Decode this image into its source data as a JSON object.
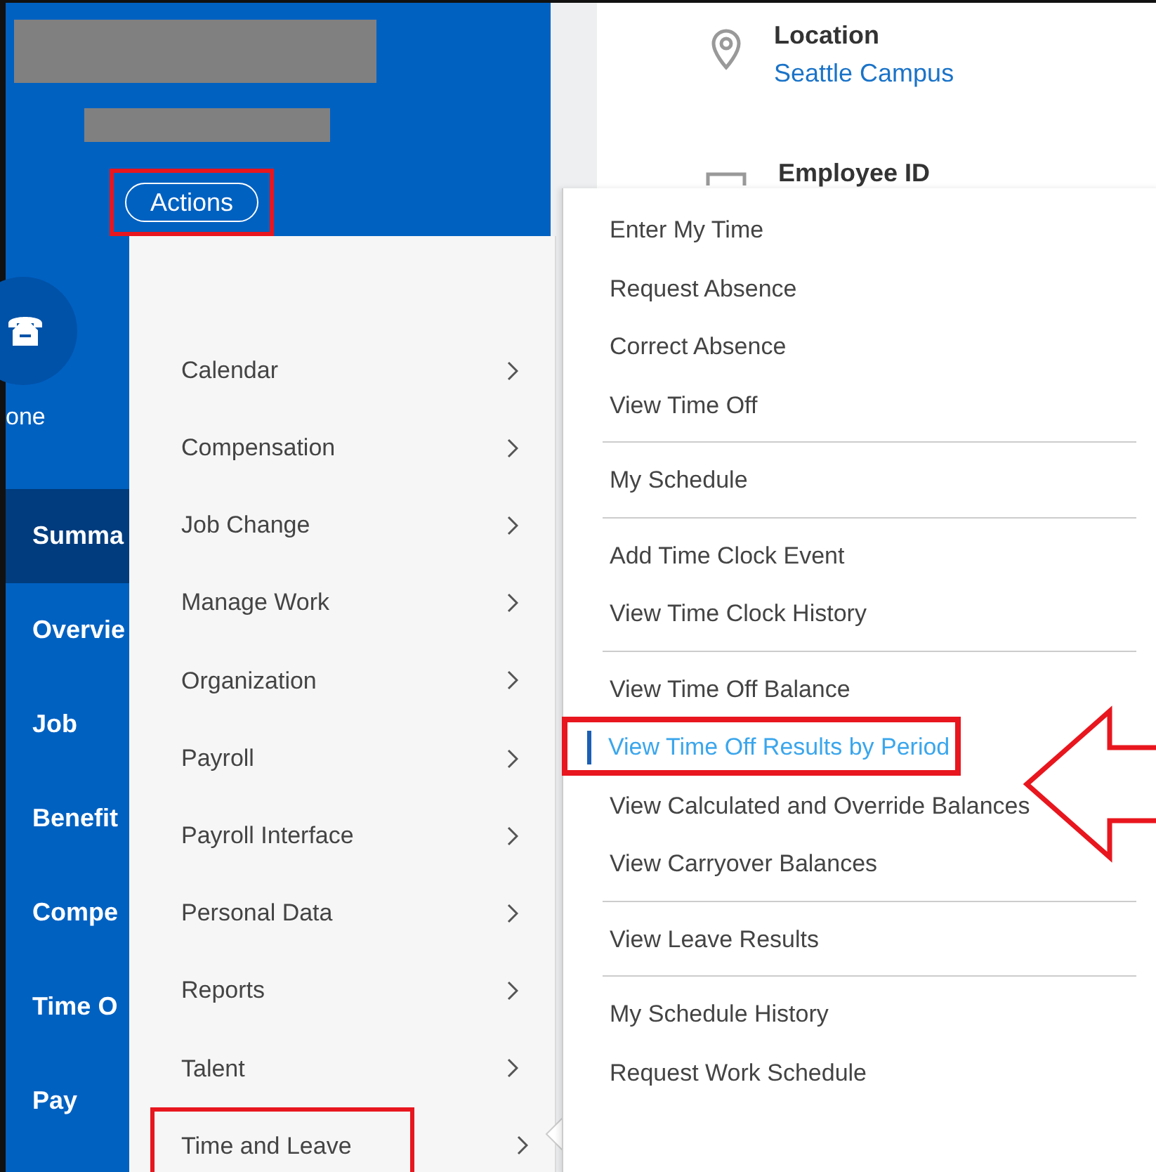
{
  "header": {
    "redactions": [
      {
        "kind": "title"
      },
      {
        "kind": "subtitle"
      }
    ],
    "actions_button": {
      "label": "Actions",
      "highlighted": true
    }
  },
  "phone": {
    "label": "one"
  },
  "nav": [
    {
      "label": "Summa",
      "selected": true
    },
    {
      "label": "Overvie",
      "selected": false
    },
    {
      "label": "Job",
      "selected": false
    },
    {
      "label": "Benefit",
      "selected": false
    },
    {
      "label": "Compe",
      "selected": false
    },
    {
      "label": "Time O",
      "selected": false
    },
    {
      "label": "Pay",
      "selected": false
    }
  ],
  "details": [
    {
      "kind": "location",
      "label": "Location",
      "value": "Seattle Campus"
    },
    {
      "kind": "id",
      "label": "Employee ID"
    }
  ],
  "actions_menu": [
    {
      "label": "Calendar",
      "highlighted": false
    },
    {
      "label": "Compensation",
      "highlighted": false
    },
    {
      "label": "Job Change",
      "highlighted": false
    },
    {
      "label": "Manage Work",
      "highlighted": false
    },
    {
      "label": "Organization",
      "highlighted": false
    },
    {
      "label": "Payroll",
      "highlighted": false
    },
    {
      "label": "Payroll Interface",
      "highlighted": false
    },
    {
      "label": "Personal Data",
      "highlighted": false
    },
    {
      "label": "Reports",
      "highlighted": false
    },
    {
      "label": "Talent",
      "highlighted": false
    },
    {
      "label": "Time and Leave",
      "highlighted": true
    }
  ],
  "submenu": [
    [
      {
        "label": "Enter My Time",
        "selected": false
      },
      {
        "label": "Request Absence",
        "selected": false
      },
      {
        "label": "Correct Absence",
        "selected": false
      },
      {
        "label": "View Time Off",
        "selected": false
      }
    ],
    [
      {
        "label": "My Schedule",
        "selected": false
      }
    ],
    [
      {
        "label": "Add Time Clock Event",
        "selected": false
      },
      {
        "label": "View Time Clock History",
        "selected": false
      }
    ],
    [
      {
        "label": "View Time Off Balance",
        "selected": false
      },
      {
        "label": "View Time Off Results by Period",
        "selected": true,
        "highlighted": true,
        "callout_arrow": true
      },
      {
        "label": "View Calculated and Override Balances",
        "selected": false
      },
      {
        "label": "View Carryover Balances",
        "selected": false
      }
    ],
    [
      {
        "label": "View Leave Results",
        "selected": false
      }
    ],
    [
      {
        "label": "My Schedule History",
        "selected": false
      },
      {
        "label": "Request Work Schedule",
        "selected": false
      }
    ]
  ]
}
